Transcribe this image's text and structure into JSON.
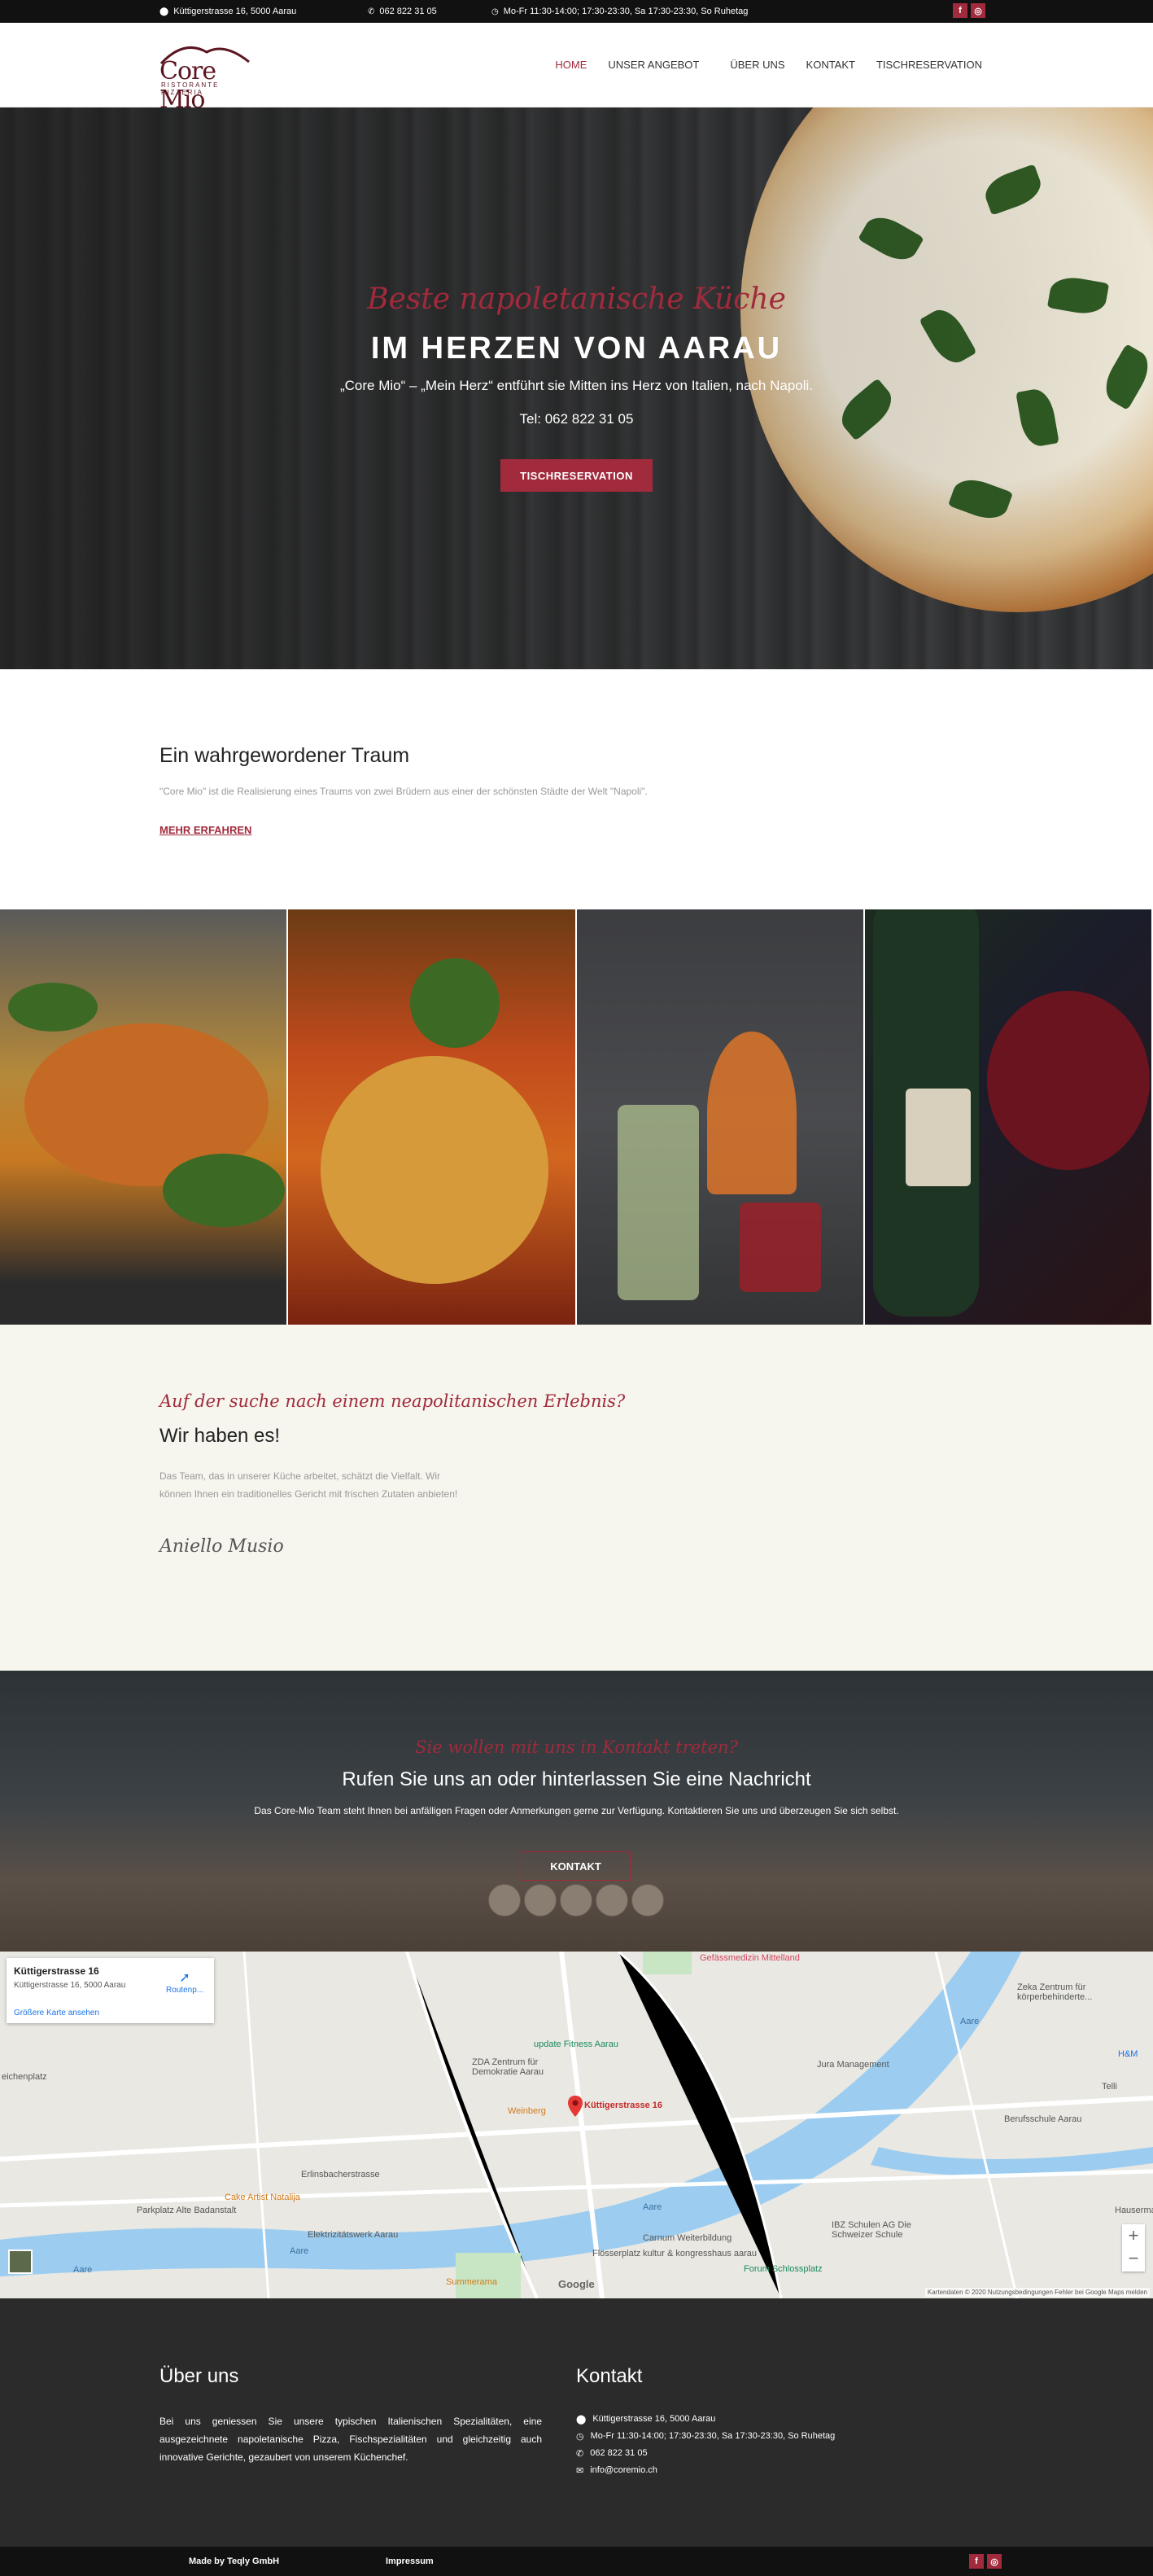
{
  "topbar": {
    "address": "Küttigerstrasse 16, 5000 Aarau",
    "phone": "062 822 31 05",
    "hours": "Mo-Fr 11:30-14:00; 17:30-23:30, Sa 17:30-23:30, So Ruhetag",
    "social": [
      "f",
      "◎"
    ]
  },
  "logo": {
    "name": "Core Mio",
    "sub": "RISTORANTE PIZZERIA"
  },
  "nav": [
    "HOME",
    "UNSER ANGEBOT",
    "ÜBER UNS",
    "KONTAKT",
    "TISCHRESERVATION"
  ],
  "hero": {
    "script": "Beste napoletanische Küche",
    "title": "IM HERZEN VON AARAU",
    "subtitle": "„Core Mio“ – „Mein Herz“ entführt sie Mitten ins Herz von Italien, nach Napoli.",
    "tel": "Tel: 062 822 31 05",
    "button": "TISCHRESERVATION"
  },
  "about": {
    "title": "Ein wahrgewordener Traum",
    "text": "\"Core Mio\" ist die Realisierung eines Traums von zwei Brüdern aus einer der schönsten Städte der Welt \"Napoli\".",
    "link": "MEHR ERFAHREN"
  },
  "team": {
    "script": "Auf der suche nach einem neapolitanischen Erlebnis?",
    "title": "Wir haben es!",
    "text": "Das Team, das in unserer Küche arbeitet, schätzt die Vielfalt. Wir können Ihnen ein traditionelles Gericht mit frischen Zutaten anbieten!",
    "signature": "Aniello Musio"
  },
  "contact": {
    "script": "Sie wollen mit uns in Kontakt treten?",
    "title": "Rufen Sie uns an oder hinterlassen Sie eine Nachricht",
    "text": "Das Core-Mio Team steht Ihnen bei anfälligen Fragen oder Anmerkungen gerne zur Verfügung. Kontaktieren Sie uns und überzeugen Sie sich selbst.",
    "button": "KONTAKT"
  },
  "map": {
    "card_title": "Küttigerstrasse 16",
    "card_address": "Küttigerstrasse 16, 5000 Aarau",
    "card_link": "Größere Karte ansehen",
    "route": "Routenp...",
    "pin_label": "Küttigerstrasse 16",
    "labels": [
      "Gefässmedizin Mittelland",
      "update Fitness Aarau",
      "ZDA Zentrum für Demokratie Aarau",
      "Jura Management",
      "Weinberg",
      "Cake Artist Natalija",
      "Parkplatz Alte Badanstalt",
      "Elektrizitätswerk Aarau",
      "Carnum Weiterbildung",
      "IBZ Schulen AG Die Schweizer Schule",
      "Forum Schlossplatz",
      "kultur & kongresshaus aarau",
      "Flösserplatz",
      "Summerama",
      "Berufsschule Aarau",
      "Zeka Zentrum für körperbehinderte...",
      "H&M",
      "Telli",
      "Hausermann AG",
      "Aare",
      "Aare",
      "Aare",
      "Aare",
      "Erlinsbacherstrasse",
      "eichenplatz"
    ],
    "footer": "Kartendaten © 2020   Nutzungsbedingungen   Fehler bei Google Maps melden",
    "google": "Google"
  },
  "footer": {
    "about_title": "Über uns",
    "about_text": "Bei uns geniessen Sie unsere typischen Italienischen Spezialitäten, eine ausgezeichnete napoletanische Pizza, Fischspezialitäten und gleichzeitig auch innovative Gerichte, gezaubert von unserem Küchenchef.",
    "contact_title": "Kontakt",
    "contact": {
      "address": "Küttigerstrasse 16, 5000 Aarau",
      "hours": "Mo-Fr 11:30-14:00; 17:30-23:30, Sa 17:30-23:30, So Ruhetag",
      "phone": "062 822 31 05",
      "email": "info@coremio.ch"
    }
  },
  "bottom": {
    "made_by": "Made by Teqly GmbH",
    "impressum": "Impressum"
  },
  "colors": {
    "accent": "#a12a3c",
    "dark": "#111111",
    "footer": "#2b2b2b",
    "cream": "#f6f5ee"
  }
}
